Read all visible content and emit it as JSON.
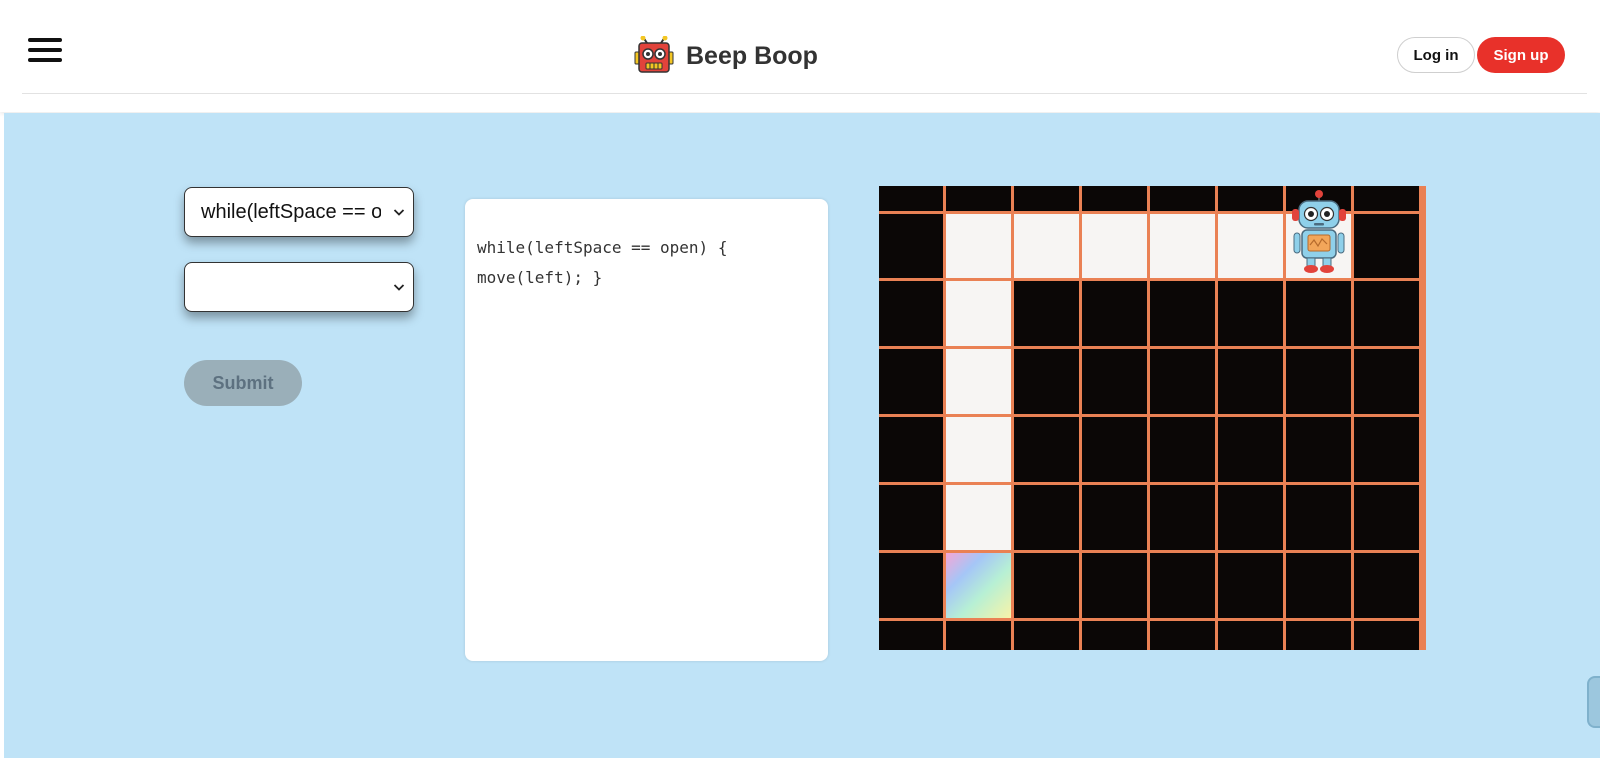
{
  "header": {
    "brand_title": "Beep Boop",
    "login_label": "Log in",
    "signup_label": "Sign up",
    "icons": {
      "menu": "hamburger-menu-icon",
      "logo": "robot-logo-icon"
    }
  },
  "controls": {
    "command_select": {
      "selected": "while(leftSpace == open) {",
      "icon": "chevron-down-icon"
    },
    "action_select": {
      "selected": "",
      "icon": "chevron-down-icon"
    },
    "submit_label": "Submit"
  },
  "code_panel": {
    "code": "while(leftSpace == open) {\nmove(left); }"
  },
  "maze": {
    "columns": 8,
    "rows": 7,
    "open_cells": [
      [
        1,
        1
      ],
      [
        2,
        1
      ],
      [
        3,
        1
      ],
      [
        4,
        1
      ],
      [
        5,
        1
      ],
      [
        6,
        1
      ],
      [
        1,
        2
      ],
      [
        1,
        3
      ],
      [
        1,
        4
      ],
      [
        1,
        5
      ]
    ],
    "goal_cell": [
      1,
      6
    ],
    "robot_cell": [
      6,
      1
    ],
    "colors": {
      "wall": "#0b0706",
      "open": "#f7f5f3",
      "grid_line": "#ea8154",
      "background": "#bfe3f7",
      "accent": "#e8312a"
    }
  }
}
